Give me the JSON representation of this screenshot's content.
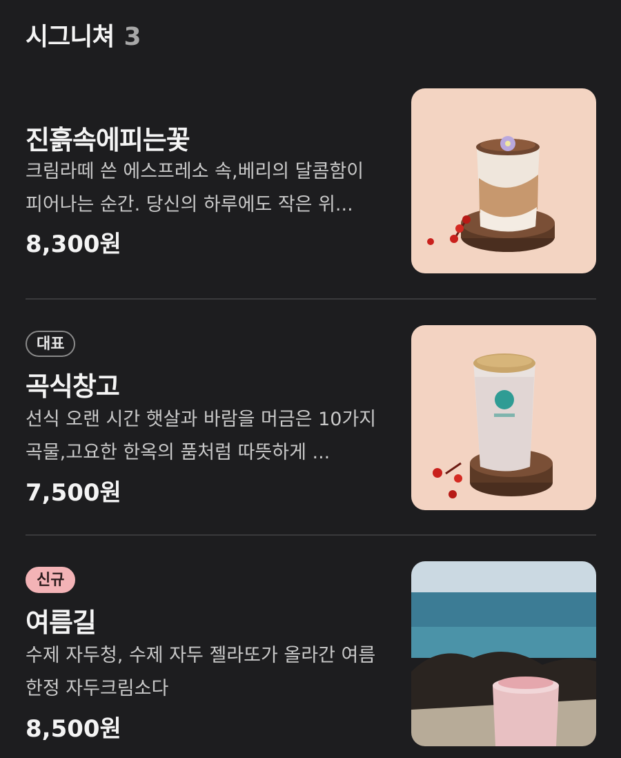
{
  "section": {
    "title": "시그니쳐",
    "count": "3"
  },
  "items": [
    {
      "badge": "",
      "name": "진흙속에피는꽃",
      "description": "크림라떼 쓴 에스프레소 속,베리의 달콤함이 피어나는 순간. 당신의 하루에도 작은 위...",
      "price": "8,300원",
      "image_icon": "latte-drink-photo"
    },
    {
      "badge": "대표",
      "name": "곡식창고",
      "description": "선식 오랜 시간 햇살과 바람을 머금은 10가지 곡물,고요한 한옥의 품처럼 따뜻하게 ...",
      "price": "7,500원",
      "image_icon": "grain-drink-photo"
    },
    {
      "badge": "신규",
      "name": "여름길",
      "description": "수제 자두청, 수제 자두 젤라또가 올라간 여름한정 자두크림소다",
      "price": "8,500원",
      "image_icon": "plum-soda-photo"
    }
  ]
}
